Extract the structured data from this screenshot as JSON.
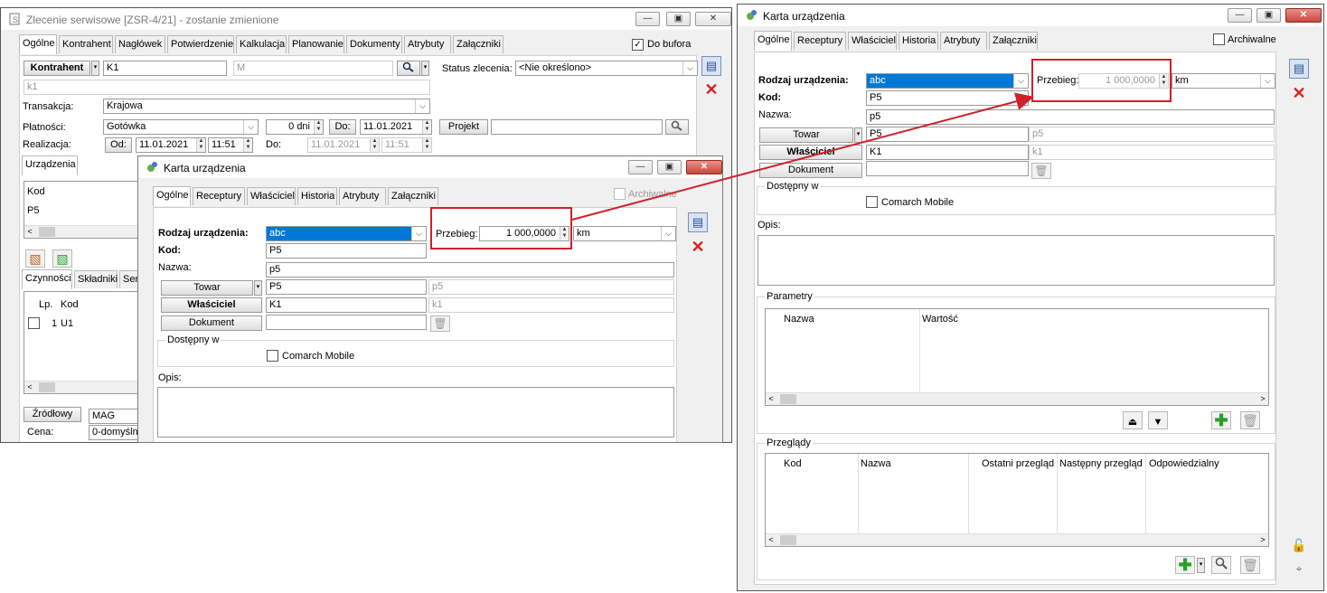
{
  "bg_window": {
    "title": "Zlecenie serwisowe [ZSR-4/21]  - zostanie zmienione",
    "tabs": [
      "Ogólne",
      "Kontrahent",
      "Nagłówek",
      "Potwierdzenie",
      "Kalkulacja",
      "Planowanie",
      "Dokumenty",
      "Atrybuty",
      "Załączniki"
    ],
    "do_bufora": "Do bufora",
    "kontrahent_label": "Kontrahent",
    "kontrahent_code": "K1",
    "kontrahent_name": "M",
    "kontrahent_sub": "k1",
    "status_label": "Status zlecenia:",
    "status_value": "<Nie określono>",
    "transakcja_label": "Transakcja:",
    "transakcja_value": "Krajowa",
    "platnosci_label": "Płatności:",
    "platnosci_value": "Gotówka",
    "dni_value": "0 dni",
    "do_label": "Do:",
    "do_date": "11.01.2021",
    "projekt_label": "Projekt",
    "realizacja_label": "Realizacja:",
    "od_label": "Od:",
    "od_date": "11.01.2021",
    "od_time": "11:51",
    "do2_label": "Do:",
    "do2_date": "11.01.2021",
    "do2_time": "11:51",
    "urzadzenia_tab": "Urządzenia",
    "kod_header": "Kod",
    "kod_row": "P5",
    "lower_tabs": [
      "Czynności",
      "Składniki",
      "Ser"
    ],
    "lp_header": "Lp.",
    "kod2_header": "Kod",
    "row_lp": "1",
    "row_kod": "U1",
    "zrodlowy_label": "Źródłowy",
    "zrodlowy_value": "MAG",
    "cena_label": "Cena:",
    "cena_value": "0-domyśln"
  },
  "card_front": {
    "title": "Karta urządzenia",
    "tabs": [
      "Ogólne",
      "Receptury",
      "Właściciel",
      "Historia",
      "Atrybuty",
      "Załączniki"
    ],
    "archiwalne": "Archiwalne",
    "rodzaj_label": "Rodzaj urządzenia:",
    "rodzaj_value": "abc",
    "kod_label": "Kod:",
    "kod_value": "P5",
    "nazwa_label": "Nazwa:",
    "nazwa_value": "p5",
    "towar_label": "Towar",
    "towar_code": "P5",
    "towar_name": "p5",
    "wlasciciel_label": "Właściciel",
    "wlasciciel_code": "K1",
    "wlasciciel_name": "k1",
    "dokument_label": "Dokument",
    "dostepny_label": "Dostępny w",
    "comarch_label": "Comarch Mobile",
    "opis_label": "Opis:",
    "przebieg_label": "Przebieg:",
    "przebieg_value": "1 000,0000",
    "unit_value": "km"
  },
  "card_right": {
    "title": "Karta urządzenia",
    "tabs": [
      "Ogólne",
      "Receptury",
      "Właściciel",
      "Historia",
      "Atrybuty",
      "Załączniki"
    ],
    "archiwalne": "Archiwalne",
    "rodzaj_label": "Rodzaj urządzenia:",
    "rodzaj_value": "abc",
    "przebieg_label": "Przebieg:",
    "przebieg_value": "1 000,0000",
    "unit_value": "km",
    "kod_label": "Kod:",
    "kod_value": "P5",
    "nazwa_label": "Nazwa:",
    "nazwa_value": "p5",
    "towar_label": "Towar",
    "towar_code": "P5",
    "towar_name": "p5",
    "wlasciciel_label": "Właściciel",
    "wlasciciel_code": "K1",
    "wlasciciel_name": "k1",
    "dokument_label": "Dokument",
    "dostepny_label": "Dostępny w",
    "comarch_label": "Comarch Mobile",
    "opis_label": "Opis:",
    "parametry_label": "Parametry",
    "param_headers": [
      "Nazwa",
      "Wartość"
    ],
    "przeglady_label": "Przeglądy",
    "przeglady_headers": [
      "Kod",
      "Nazwa",
      "Ostatni przegląd",
      "Następny przegląd",
      "Odpowiedzialny"
    ]
  },
  "colors": {
    "annotation": "#d0202a",
    "selection": "#0078d7"
  }
}
